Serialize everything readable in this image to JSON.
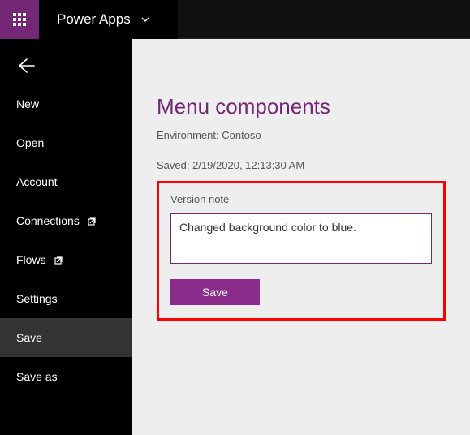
{
  "colors": {
    "accent": "#742774",
    "highlight": "#ff0000"
  },
  "header": {
    "app_name": "Power Apps"
  },
  "sidebar": {
    "items": {
      "new": "New",
      "open": "Open",
      "account": "Account",
      "connections": "Connections",
      "flows": "Flows",
      "settings": "Settings",
      "save": "Save",
      "save_as": "Save as"
    }
  },
  "main": {
    "title": "Menu components",
    "environment_label": "Environment:",
    "environment_value": "Contoso",
    "saved_label": "Saved:",
    "saved_value": "2/19/2020, 12:13:30 AM",
    "version_note_label": "Version note",
    "version_note_value": "Changed background color to blue.",
    "save_button": "Save"
  }
}
